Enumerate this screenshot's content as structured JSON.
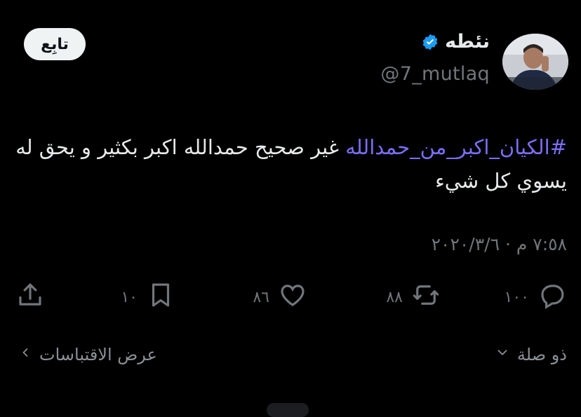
{
  "author": {
    "display_name": "نئطه",
    "handle": "@7_mutlaq",
    "verified": true,
    "verified_color": "#1d9bf0"
  },
  "follow_button": {
    "label": "تابِع"
  },
  "tweet": {
    "hashtag": "#الكيان_اكبر_من_حمدالله",
    "text": " غير صحيح حمدالله اكبر بكثير و يحق له يسوي كل شيء",
    "hashtag_color": "#7b6ef6"
  },
  "timestamp": "٧:٥٨ م · ٢٠٢٠/٣/٦",
  "actions": {
    "replies": {
      "count": "١٠٠",
      "icon": "reply-icon"
    },
    "retweets": {
      "count": "٨٨",
      "icon": "retweet-icon"
    },
    "likes": {
      "count": "٨٦",
      "icon": "heart-icon"
    },
    "bookmarks": {
      "count": "١٠",
      "icon": "bookmark-icon"
    },
    "share": {
      "icon": "share-icon"
    }
  },
  "footer": {
    "related_label": "ذو صلة",
    "quotes_label": "عرض الاقتباسات"
  }
}
